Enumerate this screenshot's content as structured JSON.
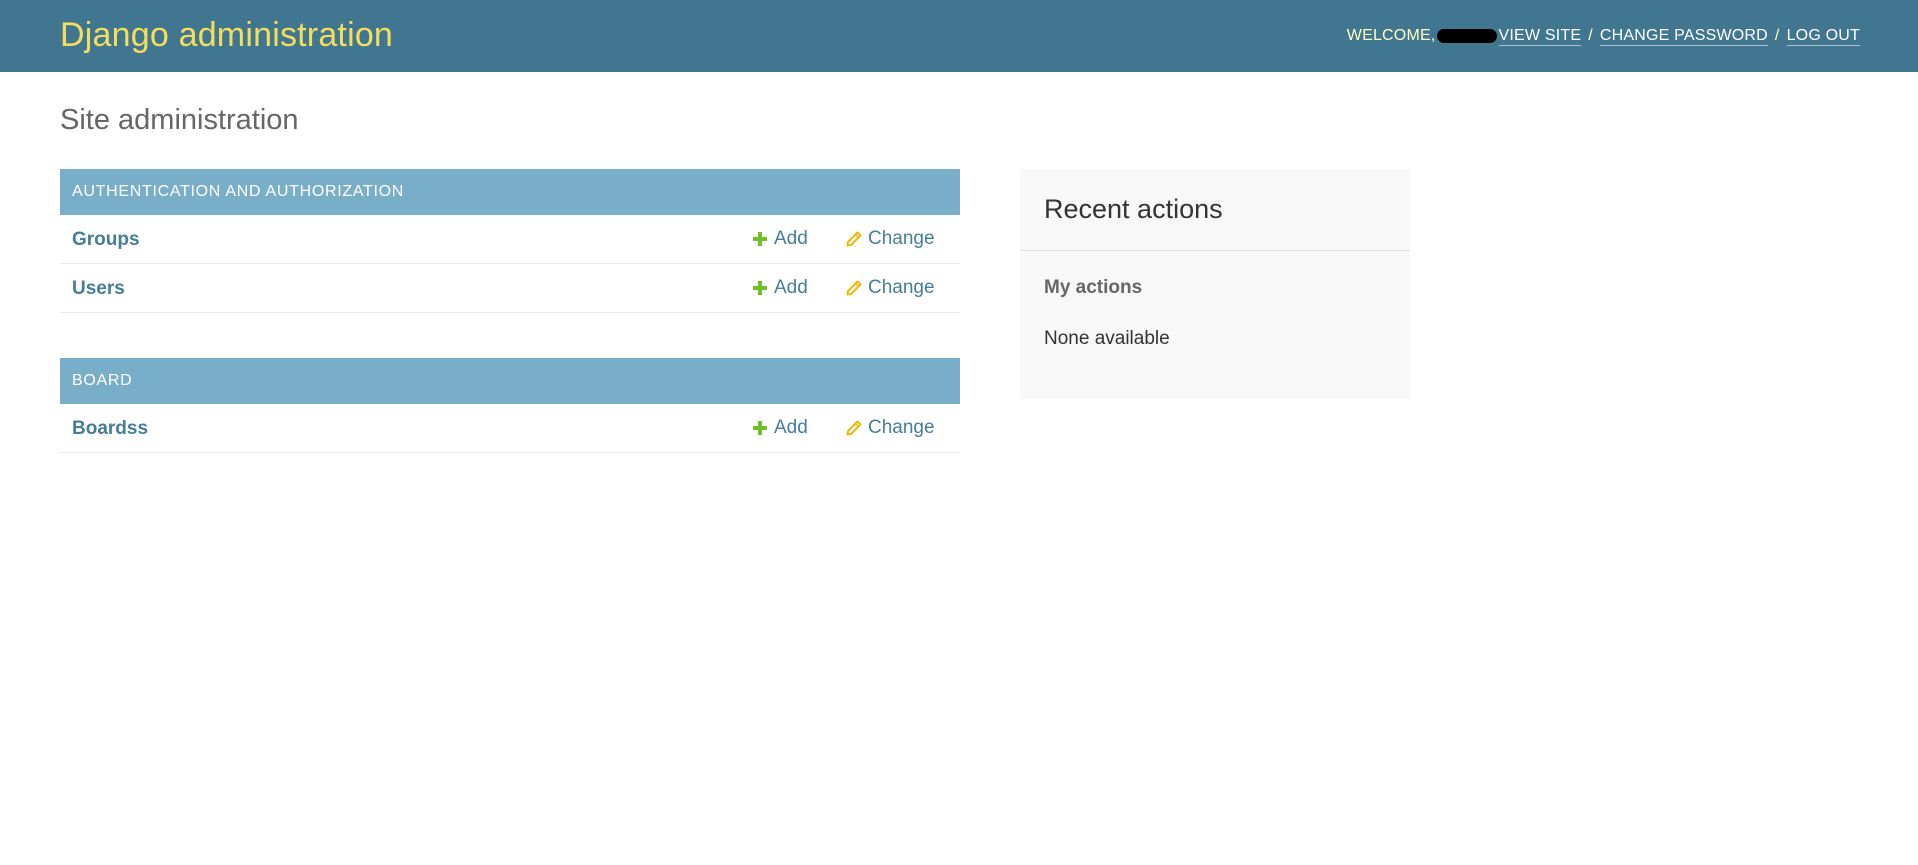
{
  "header": {
    "brand": "Django administration",
    "welcome": "WELCOME,",
    "view_site": "VIEW SITE",
    "change_password": "CHANGE PASSWORD",
    "log_out": "LOG OUT",
    "separator": "/"
  },
  "page": {
    "title": "Site administration"
  },
  "modules": [
    {
      "caption": "AUTHENTICATION AND AUTHORIZATION",
      "models": [
        {
          "name": "Groups",
          "add": "Add",
          "change": "Change"
        },
        {
          "name": "Users",
          "add": "Add",
          "change": "Change"
        }
      ]
    },
    {
      "caption": "BOARD",
      "models": [
        {
          "name": "Boardss",
          "add": "Add",
          "change": "Change"
        }
      ]
    }
  ],
  "recent_actions": {
    "title": "Recent actions",
    "subtitle": "My actions",
    "empty": "None available"
  },
  "colors": {
    "header_bg": "#417690",
    "brand": "#f5dd5d",
    "module_header_bg": "#79aec8",
    "link": "#447e9b",
    "add_icon": "#70bf2b",
    "change_icon": "#efb80b"
  },
  "icons": {
    "add": "plus-icon",
    "change": "pencil-icon"
  }
}
